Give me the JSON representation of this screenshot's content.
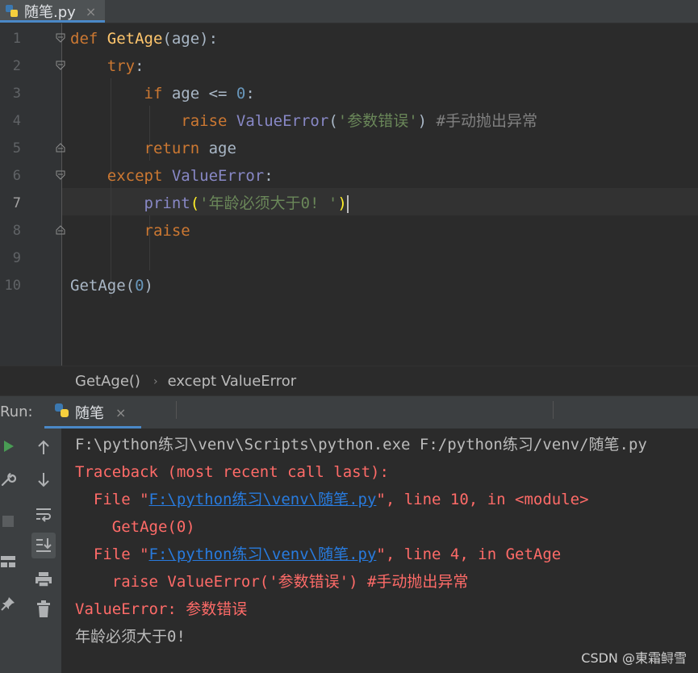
{
  "tab": {
    "label": "随笔.py",
    "close": "×"
  },
  "editor": {
    "lines": [
      {
        "num": "1",
        "tokens": [
          {
            "c": "kw",
            "t": "def "
          },
          {
            "c": "fn",
            "t": "GetAge"
          },
          {
            "c": "",
            "t": "(age):"
          }
        ]
      },
      {
        "num": "2",
        "tokens": [
          {
            "c": "",
            "t": "    "
          },
          {
            "c": "kw",
            "t": "try"
          },
          {
            "c": "",
            "t": ":"
          }
        ]
      },
      {
        "num": "3",
        "tokens": [
          {
            "c": "",
            "t": "        "
          },
          {
            "c": "kw",
            "t": "if "
          },
          {
            "c": "",
            "t": "age <= "
          },
          {
            "c": "num",
            "t": "0"
          },
          {
            "c": "",
            "t": ":"
          }
        ]
      },
      {
        "num": "4",
        "tokens": [
          {
            "c": "",
            "t": "            "
          },
          {
            "c": "kw",
            "t": "raise "
          },
          {
            "c": "blt",
            "t": "ValueError"
          },
          {
            "c": "",
            "t": "("
          },
          {
            "c": "str",
            "t": "'参数错误'"
          },
          {
            "c": "",
            "t": ") "
          },
          {
            "c": "cmt",
            "t": "#手动抛出异常"
          }
        ]
      },
      {
        "num": "5",
        "tokens": [
          {
            "c": "",
            "t": "        "
          },
          {
            "c": "kw",
            "t": "return "
          },
          {
            "c": "",
            "t": "age"
          }
        ]
      },
      {
        "num": "6",
        "tokens": [
          {
            "c": "",
            "t": "    "
          },
          {
            "c": "kw",
            "t": "except "
          },
          {
            "c": "blt",
            "t": "ValueError"
          },
          {
            "c": "",
            "t": ":"
          }
        ]
      },
      {
        "num": "7",
        "tokens": [
          {
            "c": "",
            "t": "        "
          },
          {
            "c": "blt",
            "t": "print"
          },
          {
            "c": "paren-hl",
            "t": "("
          },
          {
            "c": "str",
            "t": "'年龄必须大于0! '"
          },
          {
            "c": "paren-hl",
            "t": ")"
          }
        ],
        "current": true
      },
      {
        "num": "8",
        "tokens": [
          {
            "c": "",
            "t": "        "
          },
          {
            "c": "kw",
            "t": "raise"
          }
        ]
      },
      {
        "num": "9",
        "tokens": []
      },
      {
        "num": "10",
        "tokens": [
          {
            "c": "",
            "t": "GetAge("
          },
          {
            "c": "num",
            "t": "0"
          },
          {
            "c": "",
            "t": ")"
          }
        ]
      }
    ]
  },
  "breadcrumb": {
    "items": [
      "GetAge()",
      "except ValueError"
    ],
    "separator": "›"
  },
  "run": {
    "label": "Run:",
    "tab_label": "随笔",
    "tab_close": "×",
    "left_toolbar_1": [
      "run-icon",
      "wrench-icon",
      "stop-icon",
      "layout-icon",
      "pin-icon"
    ],
    "left_toolbar_2": [
      "up-arrow-icon",
      "down-arrow-icon",
      "soft-wrap-icon",
      "scroll-to-end-icon",
      "print-icon",
      "trash-icon"
    ]
  },
  "console": {
    "lines": [
      {
        "parts": [
          {
            "c": "c-norm",
            "t": "F:\\python练习\\venv\\Scripts\\python.exe F:/python练习/venv/随笔.py"
          }
        ]
      },
      {
        "parts": [
          {
            "c": "c-err",
            "t": "Traceback (most recent call last):"
          }
        ]
      },
      {
        "parts": [
          {
            "c": "c-err",
            "t": "  File \""
          },
          {
            "c": "c-link",
            "t": "F:\\python练习\\venv\\随笔.py"
          },
          {
            "c": "c-err",
            "t": "\", line 10, in <module>"
          }
        ]
      },
      {
        "parts": [
          {
            "c": "c-err",
            "t": "    GetAge(0)"
          }
        ]
      },
      {
        "parts": [
          {
            "c": "c-err",
            "t": "  File \""
          },
          {
            "c": "c-link",
            "t": "F:\\python练习\\venv\\随笔.py"
          },
          {
            "c": "c-err",
            "t": "\", line 4, in GetAge"
          }
        ]
      },
      {
        "parts": [
          {
            "c": "c-err",
            "t": "    raise ValueError('参数错误') #手动抛出异常"
          }
        ]
      },
      {
        "parts": [
          {
            "c": "c-err",
            "t": "ValueError: 参数错误"
          }
        ]
      },
      {
        "parts": [
          {
            "c": "c-norm",
            "t": "年龄必须大于0!"
          }
        ]
      }
    ]
  },
  "watermark": "CSDN @東霜鲟雪",
  "colors": {
    "keyword": "#cc7832",
    "function": "#ffc66d",
    "number": "#6897bb",
    "string": "#6a8759",
    "comment": "#808080",
    "builtin": "#8888c6",
    "error": "#ff6b68",
    "link": "#287bde",
    "accent": "#4a88c7"
  }
}
